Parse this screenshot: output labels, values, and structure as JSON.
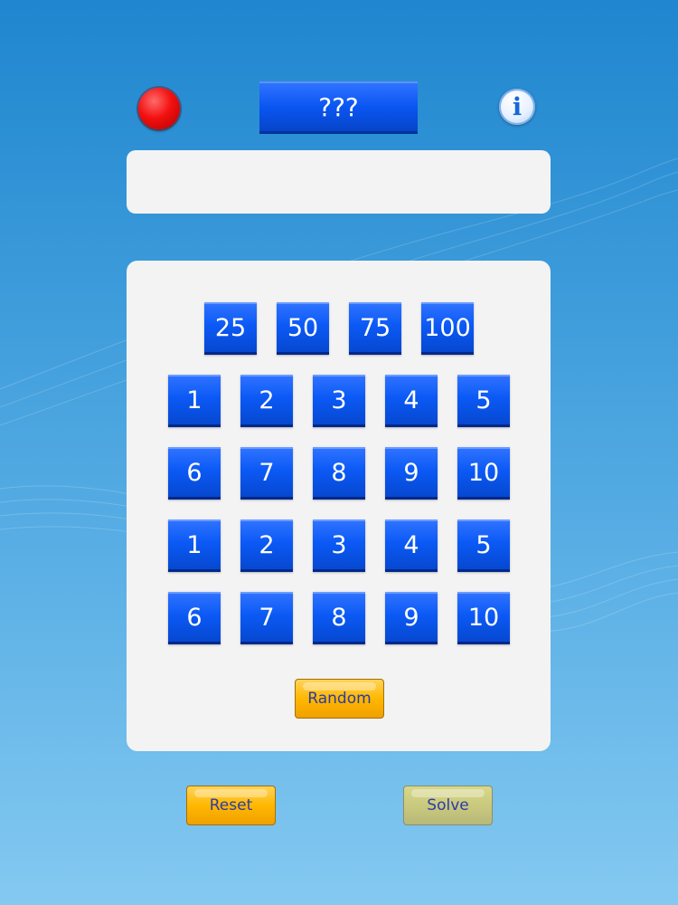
{
  "header": {
    "target_label": "???",
    "info_glyph": "i"
  },
  "display": {
    "expression": ""
  },
  "large_numbers": [
    "25",
    "50",
    "75",
    "100"
  ],
  "small_numbers_row1": [
    "1",
    "2",
    "3",
    "4",
    "5"
  ],
  "small_numbers_row2": [
    "6",
    "7",
    "8",
    "9",
    "10"
  ],
  "small_numbers_row3": [
    "1",
    "2",
    "3",
    "4",
    "5"
  ],
  "small_numbers_row4": [
    "6",
    "7",
    "8",
    "9",
    "10"
  ],
  "buttons": {
    "random": "Random",
    "reset": "Reset",
    "solve": "Solve"
  },
  "colors": {
    "tile_blue": "#0b59f5",
    "record_red": "#f31010",
    "button_orange": "#ffb800",
    "button_disabled": "#c6c67c",
    "panel": "#f3f3f4"
  },
  "icons": {
    "record": "record-icon",
    "info": "info-icon"
  }
}
